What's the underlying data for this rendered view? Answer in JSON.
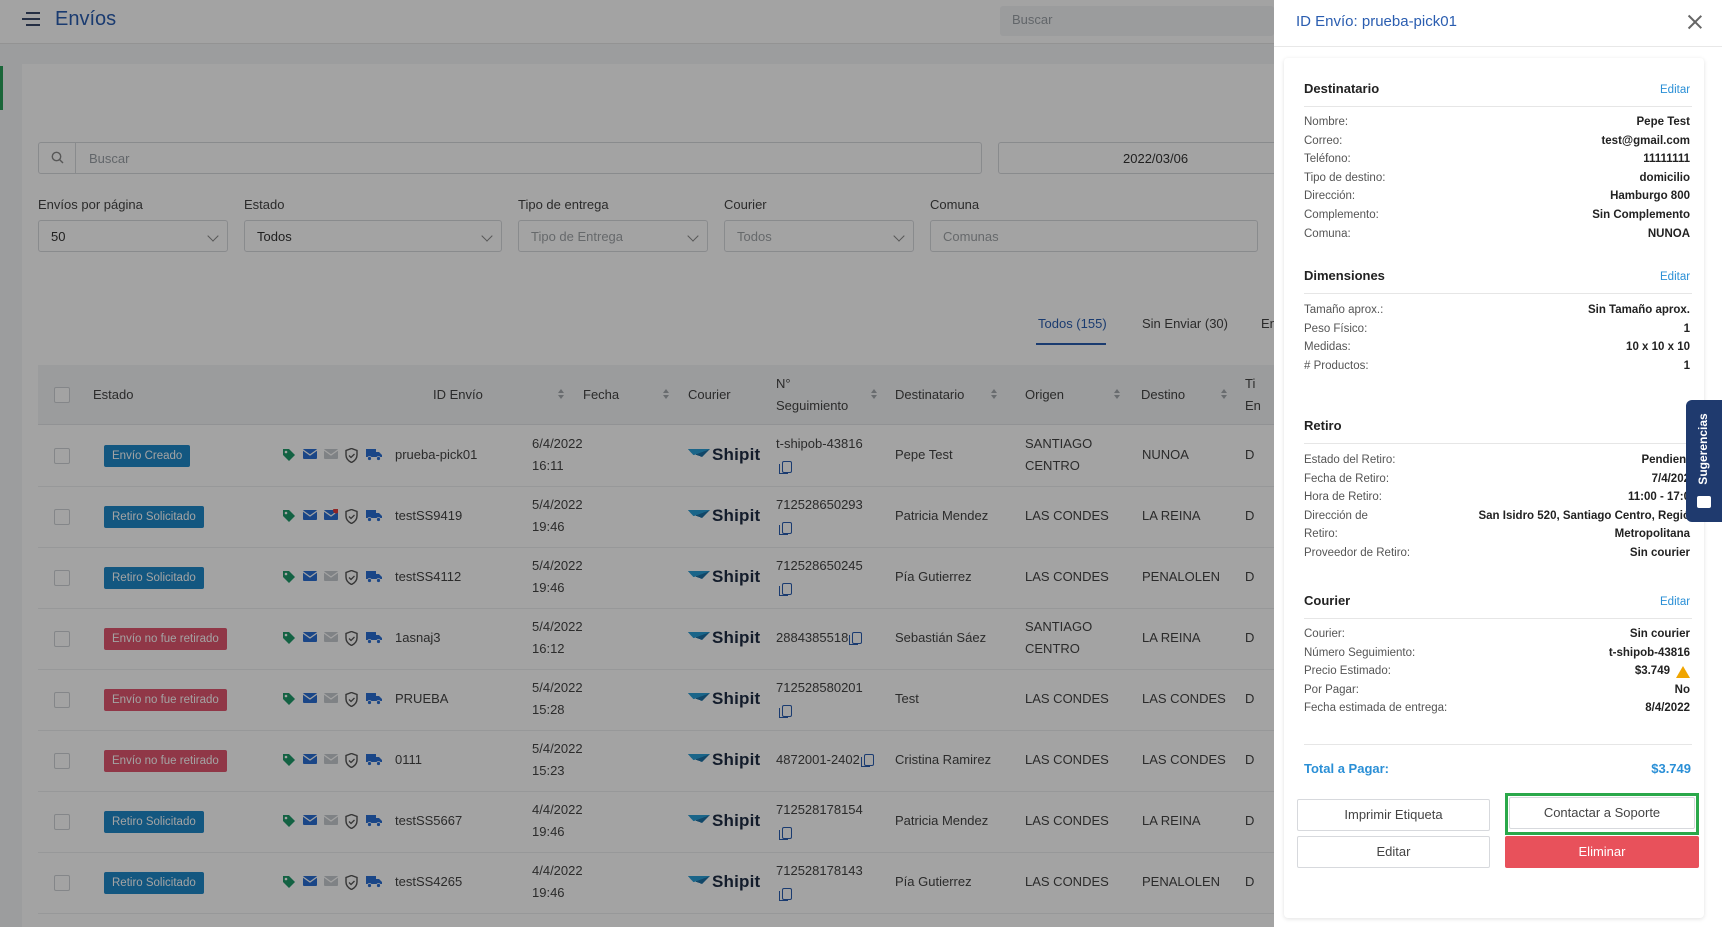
{
  "app": {
    "title": "Envíos",
    "top_search_placeholder": "Buscar"
  },
  "filters": {
    "search_placeholder": "Buscar",
    "date_value": "2022/03/06",
    "per_page_label": "Envíos por página",
    "per_page_value": "50",
    "estado_label": "Estado",
    "estado_value": "Todos",
    "tipo_label": "Tipo de entrega",
    "tipo_placeholder": "Tipo de Entrega",
    "courier_label": "Courier",
    "courier_placeholder": "Todos",
    "comuna_label": "Comuna",
    "comuna_placeholder": "Comunas"
  },
  "tabs": [
    {
      "label": "Todos (155)"
    },
    {
      "label": "Sin Enviar (30)"
    },
    {
      "label": "En"
    }
  ],
  "table": {
    "headers": {
      "estado": "Estado",
      "id": "ID Envío",
      "fecha": "Fecha",
      "courier": "Courier",
      "seguimiento_1": "N°",
      "seguimiento_2": "Seguimiento",
      "destinatario": "Destinatario",
      "origen": "Origen",
      "destino": "Destino",
      "extra_1": "Ti",
      "extra_2": "En"
    },
    "rows": [
      {
        "estado": "Envío Creado",
        "estado_color": "#1e88c8",
        "id": "prueba-pick01",
        "fecha1": "6/4/2022",
        "fecha2": "16:11",
        "courier": "Shipit",
        "seg1": "t-shipob-43816",
        "seg2": "",
        "dest": "Pepe Test",
        "origen1": "SANTIAGO",
        "origen2": "CENTRO",
        "destino": "NUNOA",
        "extra": "D"
      },
      {
        "estado": "Retiro Solicitado",
        "estado_color": "#1e88c8",
        "id": "testSS9419",
        "fecha1": "5/4/2022",
        "fecha2": "19:46",
        "courier": "Shipit",
        "seg1": "712528650293",
        "seg2": "",
        "dest": "Patricia Mendez",
        "origen1": "LAS CONDES",
        "origen2": "",
        "destino": "LA REINA",
        "extra": "D"
      },
      {
        "estado": "Retiro Solicitado",
        "estado_color": "#1e88c8",
        "id": "testSS4112",
        "fecha1": "5/4/2022",
        "fecha2": "19:46",
        "courier": "Shipit",
        "seg1": "712528650245",
        "seg2": "",
        "dest": "Pía Gutierrez",
        "origen1": "LAS CONDES",
        "origen2": "",
        "destino": "PENALOLEN",
        "extra": "D"
      },
      {
        "estado": "Envío no fue retirado",
        "estado_color": "#e2566f",
        "id": "1asnaj3",
        "fecha1": "5/4/2022",
        "fecha2": "16:12",
        "courier": "Shipit",
        "seg1": "2884385518",
        "seg2": "",
        "dest": "Sebastián Sáez",
        "origen1": "SANTIAGO",
        "origen2": "CENTRO",
        "destino": "LA REINA",
        "extra": "D"
      },
      {
        "estado": "Envío no fue retirado",
        "estado_color": "#e2566f",
        "id": "PRUEBA",
        "fecha1": "5/4/2022",
        "fecha2": "15:28",
        "courier": "Shipit",
        "seg1": "712528580201",
        "seg2": "",
        "dest": "Test",
        "origen1": "LAS CONDES",
        "origen2": "",
        "destino": "LAS CONDES",
        "extra": "D"
      },
      {
        "estado": "Envío no fue retirado",
        "estado_color": "#e2566f",
        "id": "0111",
        "fecha1": "5/4/2022",
        "fecha2": "15:23",
        "courier": "Shipit",
        "seg1": "4872001-2402",
        "seg2": "",
        "dest": "Cristina Ramirez",
        "origen1": "LAS CONDES",
        "origen2": "",
        "destino": "LAS CONDES",
        "extra": "D"
      },
      {
        "estado": "Retiro Solicitado",
        "estado_color": "#1e88c8",
        "id": "testSS5667",
        "fecha1": "4/4/2022",
        "fecha2": "19:46",
        "courier": "Shipit",
        "seg1": "712528178154",
        "seg2": "",
        "dest": "Patricia Mendez",
        "origen1": "LAS CONDES",
        "origen2": "",
        "destino": "LA REINA",
        "extra": "D"
      },
      {
        "estado": "Retiro Solicitado",
        "estado_color": "#1e88c8",
        "id": "testSS4265",
        "fecha1": "4/4/2022",
        "fecha2": "19:46",
        "courier": "Shipit",
        "seg1": "712528178143",
        "seg2": "",
        "dest": "Pía Gutierrez",
        "origen1": "LAS CONDES",
        "origen2": "",
        "destino": "PENALOLEN",
        "extra": "D"
      }
    ]
  },
  "drawer": {
    "title": "ID Envío: prueba-pick01",
    "edit_label": "Editar",
    "destinatario": {
      "title": "Destinatario",
      "items": [
        {
          "k": "Nombre:",
          "v": "Pepe Test"
        },
        {
          "k": "Correo:",
          "v": "test@gmail.com"
        },
        {
          "k": "Teléfono:",
          "v": "11111111"
        },
        {
          "k": "Tipo de destino:",
          "v": "domicilio"
        },
        {
          "k": "Dirección:",
          "v": "Hamburgo 800"
        },
        {
          "k": "Complemento:",
          "v": "Sin Complemento"
        },
        {
          "k": "Comuna:",
          "v": "NUNOA"
        }
      ]
    },
    "dimensiones": {
      "title": "Dimensiones",
      "items": [
        {
          "k": "Tamaño aprox.:",
          "v": "Sin Tamaño aprox."
        },
        {
          "k": "Peso Físico:",
          "v": "1"
        },
        {
          "k": "Medidas:",
          "v": "10 x 10 x 10"
        },
        {
          "k": "# Productos:",
          "v": "1"
        }
      ]
    },
    "retiro": {
      "title": "Retiro",
      "items": [
        {
          "k": "Estado del Retiro:",
          "v": "Pendient"
        },
        {
          "k": "Fecha de Retiro:",
          "v": "7/4/202"
        },
        {
          "k": "Hora de Retiro:",
          "v": "11:00 - 17:0"
        },
        {
          "k": "Dirección de",
          "v": "San Isidro 520, Santiago Centro, Regió"
        },
        {
          "k": "Retiro:",
          "v": "Metropolitana"
        },
        {
          "k": "Proveedor de Retiro:",
          "v": "Sin courier"
        }
      ]
    },
    "courier": {
      "title": "Courier",
      "items": [
        {
          "k": "Courier:",
          "v": "Sin courier"
        },
        {
          "k": "Número Seguimiento:",
          "v": "t-shipob-43816"
        },
        {
          "k": "Precio Estimado:",
          "v": "$3.749"
        },
        {
          "k": "Por Pagar:",
          "v": "No"
        },
        {
          "k": "Fecha estimada de entrega:",
          "v": "8/4/2022"
        }
      ]
    },
    "total_label": "Total a Pagar:",
    "total_value": "$3.749",
    "buttons": {
      "print": "Imprimir Etiqueta",
      "support": "Contactar a Soporte",
      "edit": "Editar",
      "delete": "Eliminar"
    },
    "sugerencias": "Sugerencias"
  },
  "colors": {
    "primary": "#2a5db0",
    "link": "#2a8fd6",
    "danger": "#e8515b",
    "highlight": "#2aa84a",
    "badge_blue": "#1e88c8",
    "badge_red": "#e2566f"
  }
}
